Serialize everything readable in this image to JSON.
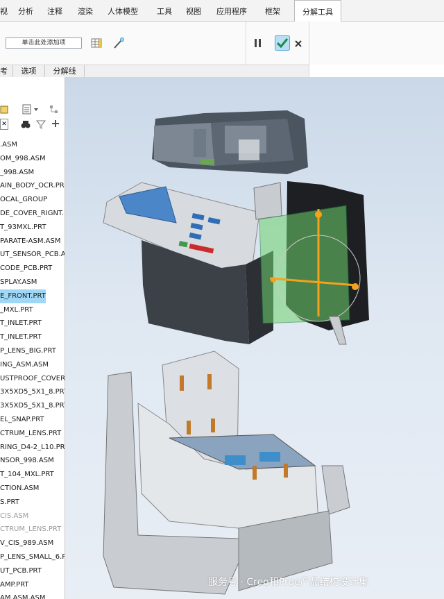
{
  "ribbon": {
    "tabs": [
      "视",
      "分析",
      "注释",
      "渲染",
      "人体模型",
      "工具",
      "视图",
      "应用程序",
      "框架",
      "分解工具"
    ],
    "active_tab": "分解工具",
    "add_item_label": "单击此处添加项"
  },
  "subtabs": [
    "考",
    "选项",
    "分解线"
  ],
  "model_tree": {
    "items": [
      {
        "label": ".ASM",
        "state": "normal"
      },
      {
        "label": "OM_998.ASM",
        "state": "normal"
      },
      {
        "label": "_998.ASM",
        "state": "normal"
      },
      {
        "label": "AIN_BODY_OCR.PR",
        "state": "normal"
      },
      {
        "label": "OCAL_GROUP",
        "state": "normal"
      },
      {
        "label": "DE_COVER_RIGNT.P",
        "state": "normal"
      },
      {
        "label": "T_93MXL.PRT",
        "state": "normal"
      },
      {
        "label": "PARATE-ASM.ASM",
        "state": "normal"
      },
      {
        "label": "UT_SENSOR_PCB.A",
        "state": "normal"
      },
      {
        "label": "CODE_PCB.PRT",
        "state": "normal"
      },
      {
        "label": "SPLAY.ASM",
        "state": "normal"
      },
      {
        "label": "E_FRONT.PRT",
        "state": "selected"
      },
      {
        "label": "_MXL.PRT",
        "state": "normal"
      },
      {
        "label": "T_INLET.PRT",
        "state": "normal"
      },
      {
        "label": "T_INLET.PRT",
        "state": "normal"
      },
      {
        "label": "P_LENS_BIG.PRT",
        "state": "normal"
      },
      {
        "label": "ING_ASM.ASM",
        "state": "normal"
      },
      {
        "label": "USTPROOF_COVER.",
        "state": "normal"
      },
      {
        "label": "3X5XD5_5X1_8.PRT",
        "state": "normal"
      },
      {
        "label": "3X5XD5_5X1_8.PRT",
        "state": "normal"
      },
      {
        "label": "EL_SNAP.PRT",
        "state": "normal"
      },
      {
        "label": "CTRUM_LENS.PRT",
        "state": "normal"
      },
      {
        "label": "RING_D4-2_L10.PRT",
        "state": "normal"
      },
      {
        "label": "NSOR_998.ASM",
        "state": "normal"
      },
      {
        "label": "T_104_MXL.PRT",
        "state": "normal"
      },
      {
        "label": "CTION.ASM",
        "state": "normal"
      },
      {
        "label": "S.PRT",
        "state": "normal"
      },
      {
        "label": "CIS.ASM",
        "state": "dim"
      },
      {
        "label": "CTRUM_LENS.PRT",
        "state": "dim"
      },
      {
        "label": "V_CIS_989.ASM",
        "state": "normal"
      },
      {
        "label": "P_LENS_SMALL_6.P",
        "state": "normal"
      },
      {
        "label": "UT_PCB.PRT",
        "state": "normal"
      },
      {
        "label": "AMP.PRT",
        "state": "normal"
      },
      {
        "label": "AM.ASM.ASM",
        "state": "normal"
      }
    ]
  },
  "watermark": "服务号 · Creo和Proe产品结构设计集",
  "colors": {
    "accent": "#3a9ad9",
    "confirm": "#2a9a5a",
    "selection": "#9fd7f7",
    "drag_handle": "#f5a21b",
    "drag_axis": "#1b7a3d"
  },
  "icons": [
    "pause-icon",
    "confirm-check-icon",
    "close-icon",
    "grid-icon",
    "wand-icon",
    "binoculars-icon",
    "filter-icon",
    "add-icon"
  ]
}
